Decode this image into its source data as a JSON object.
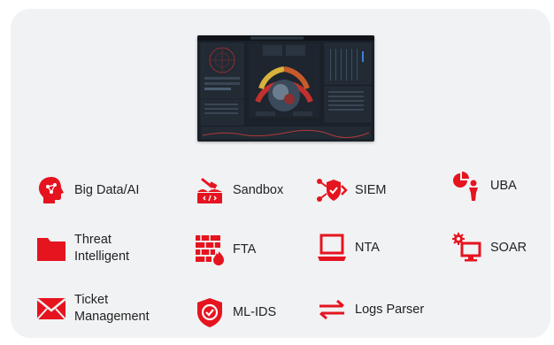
{
  "accent_color": "#e5141f",
  "dashboard": {
    "icon": "security-dashboard-screenshot"
  },
  "features": {
    "big_data": {
      "label": "Big Data/AI",
      "icon": "brain-head-icon"
    },
    "sandbox": {
      "label": "Sandbox",
      "icon": "sandbox-box-icon"
    },
    "siem": {
      "label": "SIEM",
      "icon": "shield-network-icon"
    },
    "uba": {
      "label": "UBA",
      "icon": "user-chart-icon"
    },
    "threat": {
      "label": "Threat\nIntelligent",
      "icon": "folder-icon"
    },
    "fta": {
      "label": "FTA",
      "icon": "firewall-icon"
    },
    "nta": {
      "label": "NTA",
      "icon": "laptop-icon"
    },
    "soar": {
      "label": "SOAR",
      "icon": "gear-monitor-icon"
    },
    "ticket": {
      "label": "Ticket\nManagement",
      "icon": "envelope-icon"
    },
    "mlids": {
      "label": "ML-IDS",
      "icon": "shield-check-icon"
    },
    "logs": {
      "label": "Logs Parser",
      "icon": "arrows-exchange-icon"
    }
  }
}
